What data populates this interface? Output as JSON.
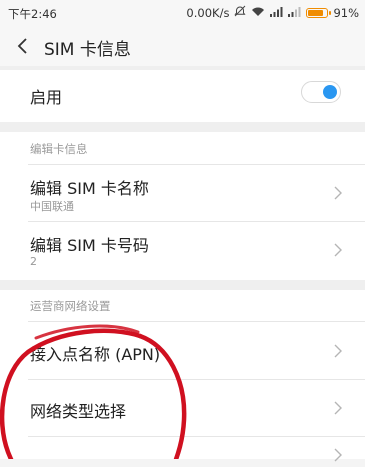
{
  "status_bar": {
    "time": "下午2:46",
    "network_speed": "0.00K/s",
    "battery_percent": "91%",
    "battery_level": 0.91
  },
  "header": {
    "title": "SIM 卡信息"
  },
  "enable_row": {
    "label": "启用",
    "enabled": true
  },
  "edit_section": {
    "header": "编辑卡信息",
    "items": [
      {
        "title": "编辑 SIM 卡名称",
        "subtitle": "中国联通"
      },
      {
        "title": "编辑 SIM 卡号码",
        "subtitle": "2"
      }
    ]
  },
  "carrier_section": {
    "header": "运营商网络设置",
    "items": [
      {
        "title": "接入点名称 (APN)"
      },
      {
        "title": "网络类型选择"
      }
    ]
  },
  "colors": {
    "accent": "#2a97f1",
    "annotation": "#d01020",
    "battery": "#f08c00"
  }
}
